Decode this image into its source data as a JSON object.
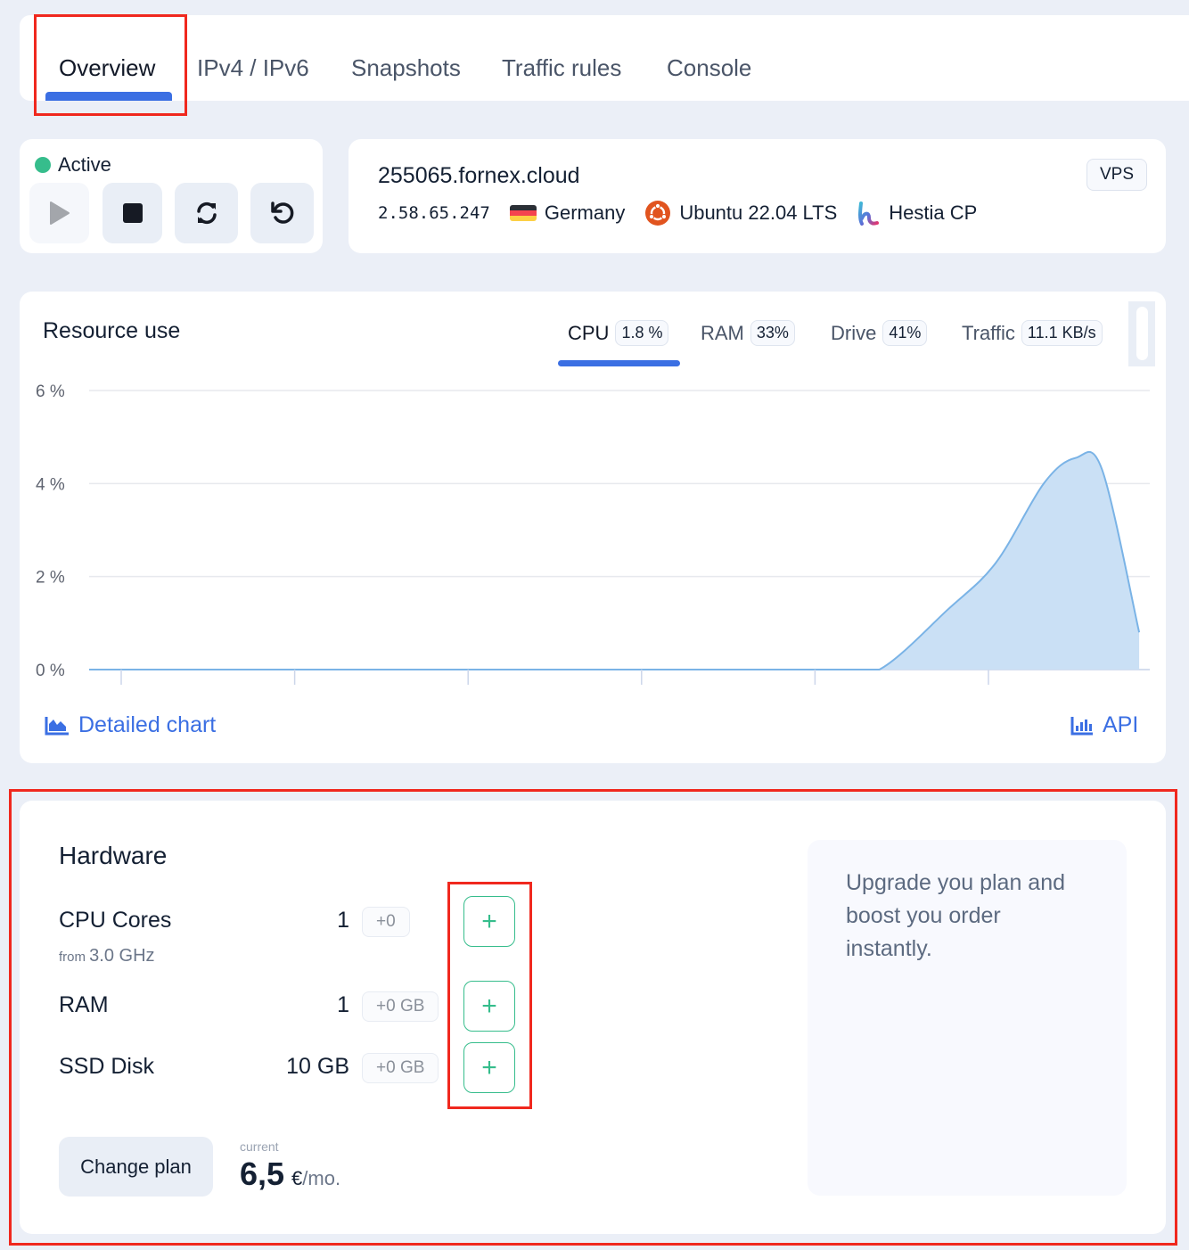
{
  "tabs": [
    {
      "label": "Overview",
      "active": true
    },
    {
      "label": "IPv4 / IPv6",
      "active": false
    },
    {
      "label": "Snapshots",
      "active": false
    },
    {
      "label": "Traffic rules",
      "active": false
    },
    {
      "label": "Console",
      "active": false
    }
  ],
  "status": {
    "label": "Active",
    "color": "#36bd8c",
    "controls": [
      {
        "name": "start",
        "icon": "play-icon",
        "enabled": false
      },
      {
        "name": "stop",
        "icon": "stop-icon",
        "enabled": true
      },
      {
        "name": "restart",
        "icon": "refresh-icon",
        "enabled": true
      },
      {
        "name": "reinstall",
        "icon": "undo-icon",
        "enabled": true
      }
    ]
  },
  "server": {
    "hostname": "255065.fornex.cloud",
    "ip": "2.58.65.247",
    "country": "Germany",
    "os": "Ubuntu 22.04 LTS",
    "panel": "Hestia CP",
    "type_badge": "VPS"
  },
  "resources": {
    "title": "Resource use",
    "tabs": [
      {
        "label": "CPU",
        "value": "1.8 %",
        "active": true
      },
      {
        "label": "RAM",
        "value": "33%",
        "active": false
      },
      {
        "label": "Drive",
        "value": "41%",
        "active": false
      },
      {
        "label": "Traffic",
        "value": "11.1 KB/s",
        "active": false
      }
    ],
    "detailed_link": "Detailed chart",
    "api_link": "API"
  },
  "chart_data": {
    "type": "area",
    "title": "",
    "xlabel": "",
    "ylabel": "",
    "y_tick_labels": [
      "0 %",
      "2 %",
      "4 %",
      "6 %"
    ],
    "y_ticks": [
      0,
      2,
      4,
      6
    ],
    "ylim": [
      0,
      6
    ],
    "x_tick_count": 6,
    "grid": true,
    "series": [
      {
        "name": "CPU",
        "x": [
          0,
          0.1,
          0.2,
          0.3,
          0.4,
          0.5,
          0.6,
          0.7,
          0.745,
          0.81,
          0.855,
          0.9,
          0.93,
          0.955,
          0.99
        ],
        "values": [
          0,
          0,
          0,
          0,
          0,
          0,
          0,
          0,
          0,
          1.3,
          2.3,
          4.0,
          4.55,
          4.3,
          0.8
        ]
      }
    ],
    "color": "#7ab3e6",
    "fill": "#cae0f5"
  },
  "hardware": {
    "title": "Hardware",
    "rows": [
      {
        "label": "CPU Cores",
        "value": "1",
        "delta": "+0",
        "sub_prefix": "from",
        "sub_value": "3.0 GHz"
      },
      {
        "label": "RAM",
        "value": "1",
        "delta": "+0 GB"
      },
      {
        "label": "SSD Disk",
        "value": "10 GB",
        "delta": "+0 GB"
      }
    ],
    "change_plan": "Change plan",
    "price_label": "current",
    "price": "6,5",
    "currency": "€",
    "period": "/mo.",
    "upgrade_text": "Upgrade you plan and boost you order instantly."
  }
}
